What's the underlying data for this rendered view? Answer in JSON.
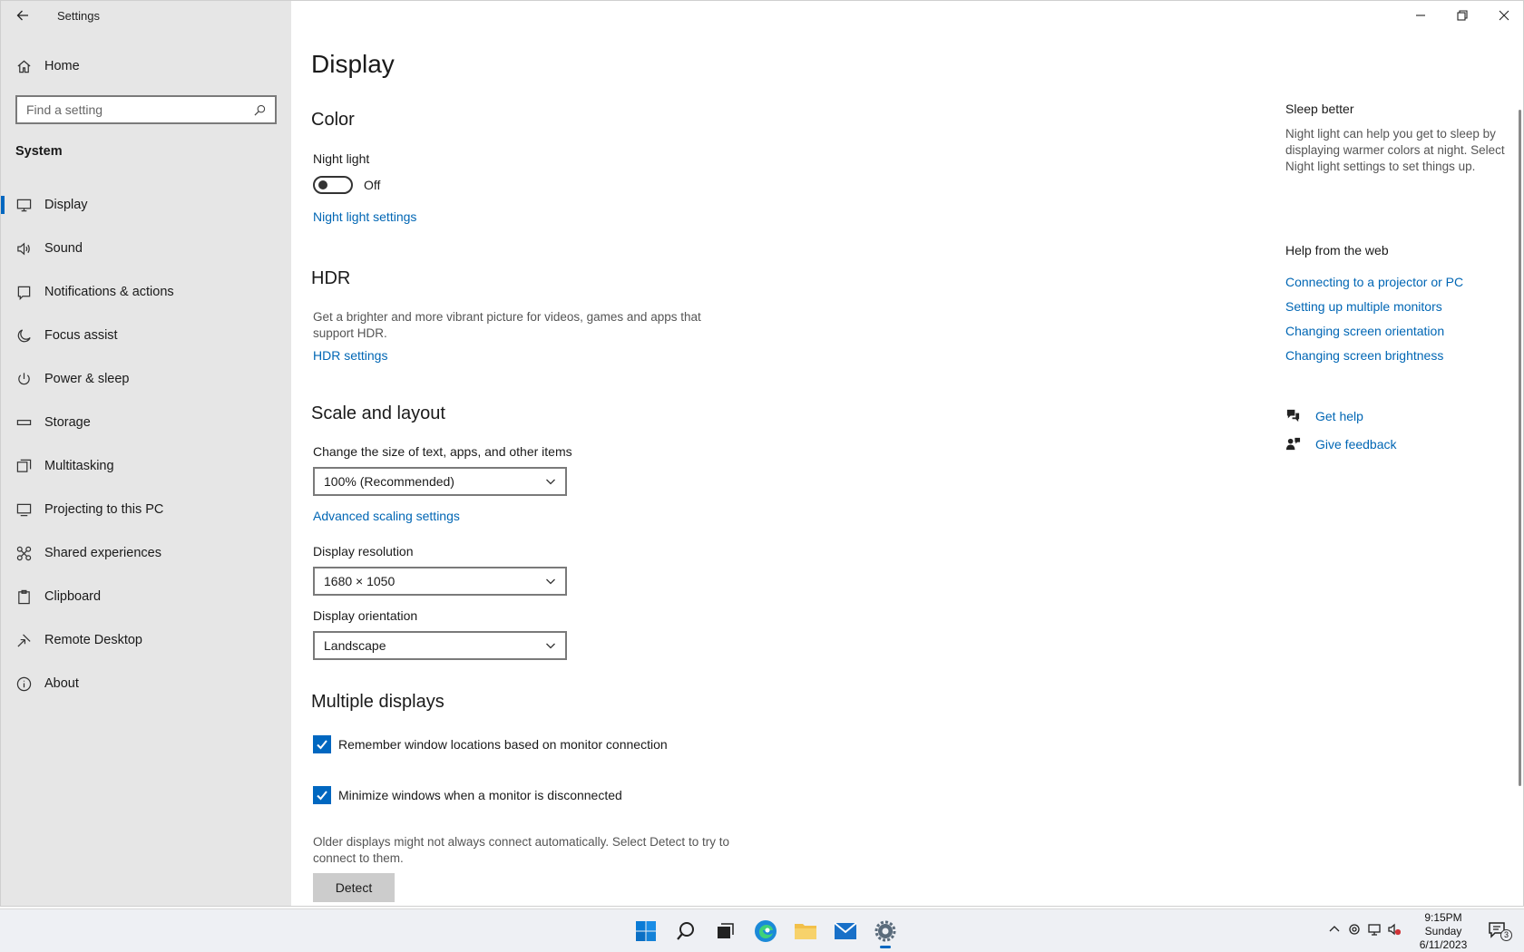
{
  "window": {
    "title": "Settings"
  },
  "sidebar": {
    "home": "Home",
    "search_placeholder": "Find a setting",
    "section": "System",
    "items": [
      {
        "label": "Display",
        "icon": "monitor-icon",
        "active": true
      },
      {
        "label": "Sound",
        "icon": "speaker-icon"
      },
      {
        "label": "Notifications & actions",
        "icon": "notification-icon"
      },
      {
        "label": "Focus assist",
        "icon": "moon-icon"
      },
      {
        "label": "Power & sleep",
        "icon": "power-icon"
      },
      {
        "label": "Storage",
        "icon": "storage-icon"
      },
      {
        "label": "Multitasking",
        "icon": "multitasking-icon"
      },
      {
        "label": "Projecting to this PC",
        "icon": "projector-icon"
      },
      {
        "label": "Shared experiences",
        "icon": "shared-experiences-icon"
      },
      {
        "label": "Clipboard",
        "icon": "clipboard-icon"
      },
      {
        "label": "Remote Desktop",
        "icon": "remote-desktop-icon"
      },
      {
        "label": "About",
        "icon": "info-icon"
      }
    ]
  },
  "main": {
    "title": "Display",
    "color": {
      "heading": "Color",
      "night_light_label": "Night light",
      "night_light_state": "Off",
      "night_light_on": false,
      "night_light_link": "Night light settings"
    },
    "hdr": {
      "heading": "HDR",
      "description": "Get a brighter and more vibrant picture for videos, games and apps that support HDR.",
      "link": "HDR settings"
    },
    "scale": {
      "heading": "Scale and layout",
      "size_label": "Change the size of text, apps, and other items",
      "size_value": "100% (Recommended)",
      "advanced_link": "Advanced scaling settings",
      "resolution_label": "Display resolution",
      "resolution_value": "1680 × 1050",
      "orientation_label": "Display orientation",
      "orientation_value": "Landscape"
    },
    "multiple": {
      "heading": "Multiple displays",
      "check1": "Remember window locations based on monitor connection",
      "check2": "Minimize windows when a monitor is disconnected",
      "description": "Older displays might not always connect automatically. Select Detect to try to connect to them.",
      "detect_button": "Detect"
    }
  },
  "aside": {
    "sleep_heading": "Sleep better",
    "sleep_desc": "Night light can help you get to sleep by displaying warmer colors at night. Select Night light settings to set things up.",
    "help_heading": "Help from the web",
    "links": [
      "Connecting to a projector or PC",
      "Setting up multiple monitors",
      "Changing screen orientation",
      "Changing screen brightness"
    ],
    "get_help": "Get help",
    "give_feedback": "Give feedback"
  },
  "taskbar": {
    "time": "9:15PM",
    "day": "Sunday",
    "date": "6/11/2023",
    "notification_count": "3"
  },
  "colors": {
    "accent": "#0067c0",
    "link": "#0066b4",
    "sidebar_bg": "#e6e6e6"
  }
}
